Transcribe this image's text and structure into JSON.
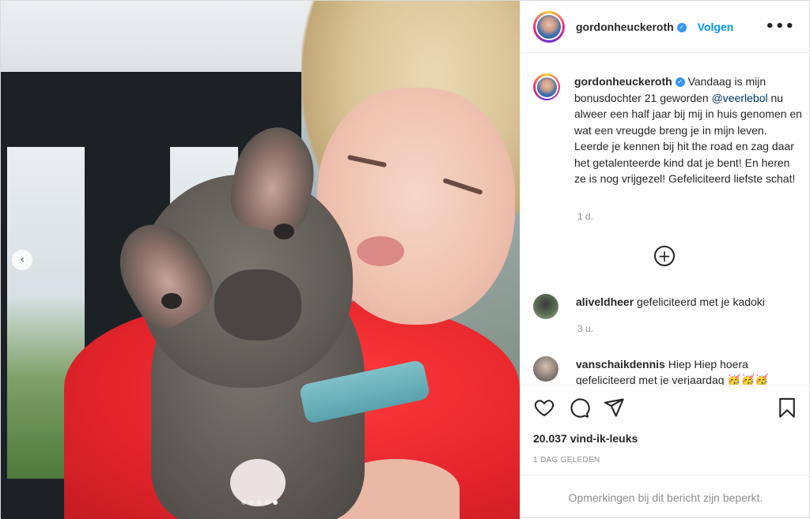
{
  "header": {
    "username": "gordonheuckeroth",
    "follow_label": "Volgen",
    "more_label": "•••"
  },
  "caption": {
    "username": "gordonheuckeroth",
    "text_part1": "Vandaag is mijn bonusdochter 21 geworden ",
    "mention": "@veerlebol",
    "text_part2": " nu alweer een half jaar bij mij in huis genomen en wat een vreugde breng je in mijn leven. Leerde je kennen bij hit the road en zag daar het getalenteerde kind dat je bent! En heren ze is nog vrijgezel! Gefeliciteerd liefste schat!",
    "time": "1 d."
  },
  "comments": [
    {
      "username": "aliveldheer",
      "text": "gefeliciteerd met je kadoki",
      "time": "3 u."
    },
    {
      "username": "vanschaikdennis",
      "text": "Hiep Hiep hoera gefeliciteerd met je verjaardag 🥳🥳🥳",
      "time": ""
    }
  ],
  "carousel": {
    "prev_label": "‹",
    "count": 5,
    "active_index": 4
  },
  "likes": "20.037 vind-ik-leuks",
  "posted": "1 DAG GELEDEN",
  "restricted": "Opmerkingen bij dit bericht zijn beperkt.",
  "icons": [
    "heart-icon",
    "comment-icon",
    "share-icon",
    "bookmark-icon",
    "plus-circle-icon",
    "verified-badge-icon",
    "chevron-left-icon"
  ]
}
